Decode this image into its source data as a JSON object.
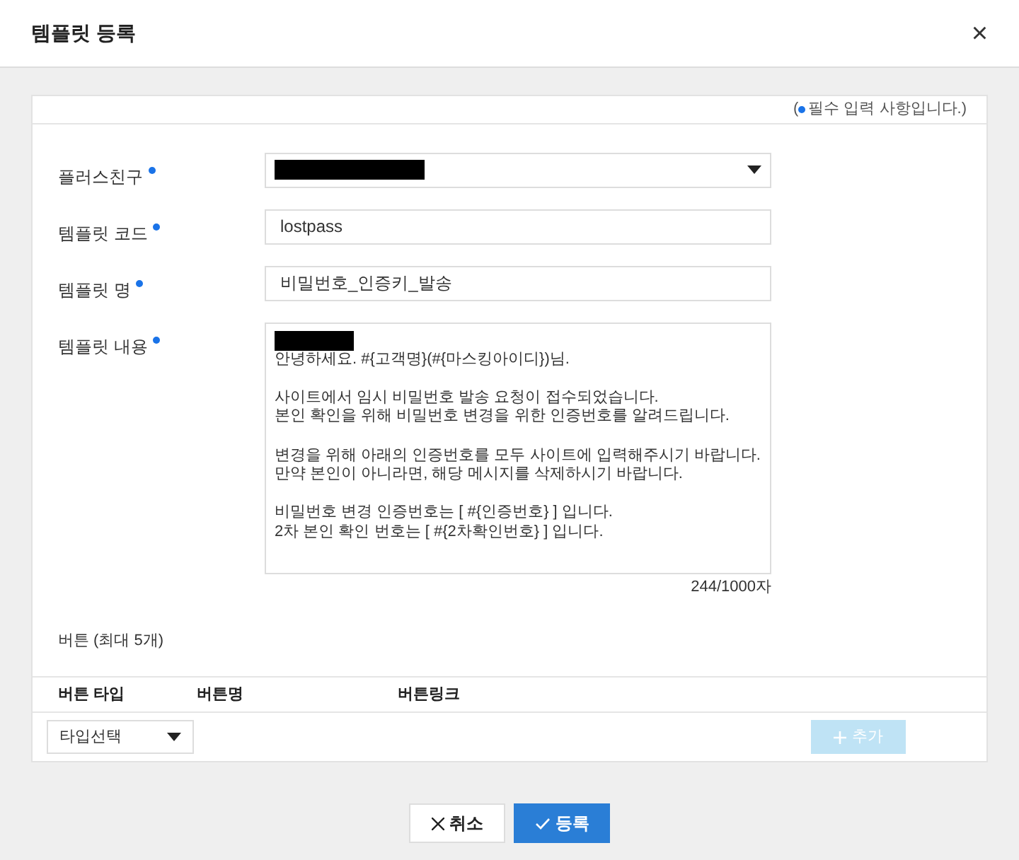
{
  "dialog": {
    "title": "템플릿 등록",
    "close": "×"
  },
  "required_note": {
    "before": "(",
    "after": "필수 입력 사항입니다.)"
  },
  "fields": [
    {
      "kind": "select",
      "label": "플러스친구",
      "required": true,
      "redacted": true
    },
    {
      "kind": "text",
      "label": "템플릿 코드",
      "required": true,
      "value": "lostpass"
    },
    {
      "kind": "text",
      "label": "템플릿 명",
      "required": true,
      "value": "비밀번호_인증키_발송"
    },
    {
      "kind": "textarea",
      "label": "템플릿 내용",
      "required": true,
      "redacted": true,
      "value": "안녕하세요. #{고객명}(#{마스킹아이디})님.\n\n사이트에서 임시 비밀번호 발송 요청이 접수되었습니다.\n본인 확인을 위해 비밀번호 변경을 위한 인증번호를 알려드립니다.\n\n변경을 위해 아래의 인증번호를 모두 사이트에 입력해주시기 바랍니다.\n만약 본인이 아니라면, 해당 메시지를 삭제하시기 바랍니다.\n\n비밀번호 변경 인증번호는 [ #{인증번호} ] 입니다.\n2차 본인 확인 번호는 [ #{2차확인번호} ] 입니다.",
      "counter": "244/1000자"
    }
  ],
  "buttons_section": {
    "title": "버튼 (최대 5개)",
    "columns": [
      "버튼 타입",
      "버튼명",
      "버튼링크"
    ],
    "type_select": "타입선택",
    "add_button": {
      "label": "추가",
      "disabled": true
    }
  },
  "footer": [
    {
      "kind": "cancel",
      "label": "취소"
    },
    {
      "kind": "submit",
      "label": "등록"
    }
  ]
}
